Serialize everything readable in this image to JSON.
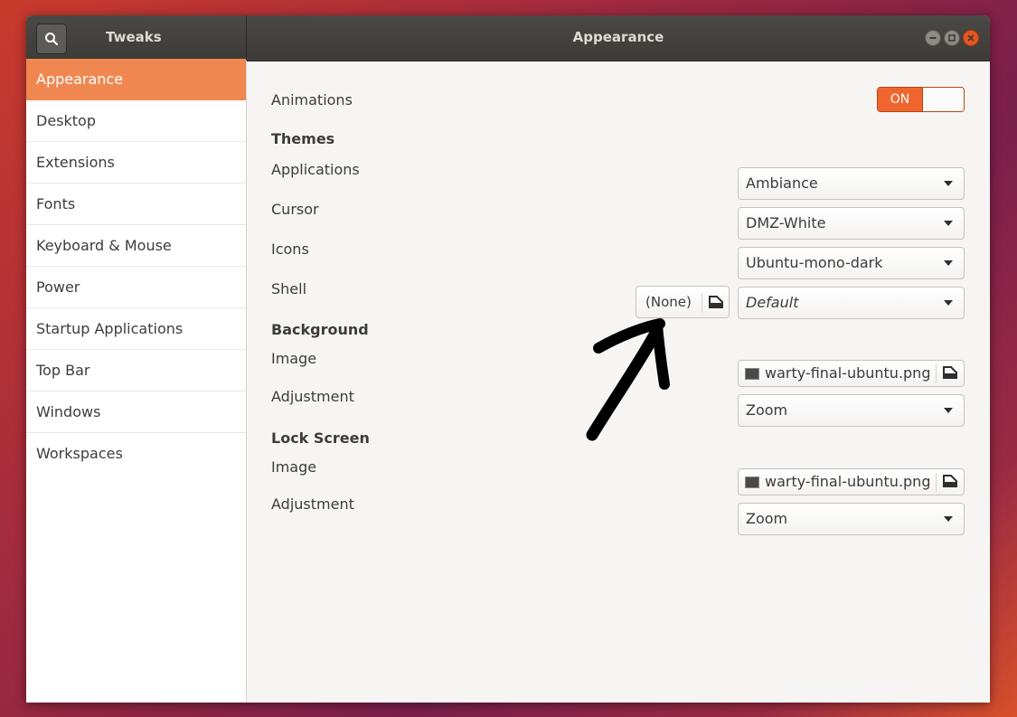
{
  "titlebar": {
    "app_title": "Tweaks",
    "page_title": "Appearance"
  },
  "sidebar": {
    "items": [
      {
        "label": "Appearance",
        "active": true
      },
      {
        "label": "Desktop"
      },
      {
        "label": "Extensions"
      },
      {
        "label": "Fonts"
      },
      {
        "label": "Keyboard & Mouse"
      },
      {
        "label": "Power"
      },
      {
        "label": "Startup Applications"
      },
      {
        "label": "Top Bar"
      },
      {
        "label": "Windows"
      },
      {
        "label": "Workspaces"
      }
    ]
  },
  "main": {
    "animations": {
      "label": "Animations",
      "toggle": "ON"
    },
    "themes": {
      "header": "Themes",
      "applications": {
        "label": "Applications",
        "value": "Ambiance"
      },
      "cursor": {
        "label": "Cursor",
        "value": "DMZ-White"
      },
      "icons": {
        "label": "Icons",
        "value": "Ubuntu-mono-dark"
      },
      "shell": {
        "label": "Shell",
        "none_button": "(None)",
        "value": "Default"
      }
    },
    "background": {
      "header": "Background",
      "image": {
        "label": "Image",
        "value": "warty-final-ubuntu.png"
      },
      "adjustment": {
        "label": "Adjustment",
        "value": "Zoom"
      }
    },
    "lock_screen": {
      "header": "Lock Screen",
      "image": {
        "label": "Image",
        "value": "warty-final-ubuntu.png"
      },
      "adjustment": {
        "label": "Adjustment",
        "value": "Zoom"
      }
    }
  },
  "colors": {
    "accent": "#f08750",
    "toggle_on": "#f0652d",
    "close_button": "#e95420",
    "titlebar": "#3c3b37"
  },
  "icons": [
    "search-icon",
    "minimize-icon",
    "maximize-icon",
    "close-icon",
    "eject-icon",
    "image-thumbnail-icon",
    "chevron-down-icon"
  ]
}
